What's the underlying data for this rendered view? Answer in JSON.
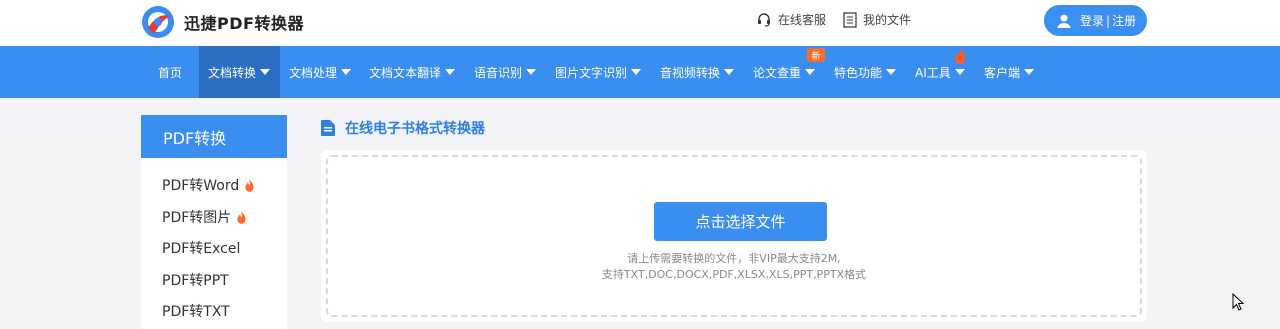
{
  "header": {
    "logo_text": "迅捷PDF转换器",
    "customer_service": "在线客服",
    "my_files": "我的文件",
    "login": "登录",
    "register": "注册",
    "login_sep": "|"
  },
  "nav": {
    "items": [
      {
        "label": "首页",
        "dropdown": false
      },
      {
        "label": "文档转换",
        "dropdown": true,
        "active": true
      },
      {
        "label": "文档处理",
        "dropdown": true
      },
      {
        "label": "文档文本翻译",
        "dropdown": true
      },
      {
        "label": "语音识别",
        "dropdown": true
      },
      {
        "label": "图片文字识别",
        "dropdown": true
      },
      {
        "label": "音视频转换",
        "dropdown": true
      },
      {
        "label": "论文查重",
        "dropdown": true
      },
      {
        "label": "特色功能",
        "dropdown": true
      },
      {
        "label": "AI工具",
        "dropdown": true
      },
      {
        "label": "客户端",
        "dropdown": true
      }
    ],
    "new_badge": "新"
  },
  "sidebar": {
    "title": "PDF转换",
    "items": [
      {
        "label": "PDF转Word",
        "hot": true
      },
      {
        "label": "PDF转图片",
        "hot": true
      },
      {
        "label": "PDF转Excel",
        "hot": false
      },
      {
        "label": "PDF转PPT",
        "hot": false
      },
      {
        "label": "PDF转TXT",
        "hot": false
      }
    ]
  },
  "main": {
    "title": "在线电子书格式转换器",
    "upload_button": "点击选择文件",
    "hint_line1": "请上传需要转换的文件，非VIP最大支持2M,",
    "hint_line2": "支持TXT,DOC,DOCX,PDF,XLSX,XLS,PPT,PPTX格式"
  },
  "colors": {
    "primary": "#3a8ef0",
    "nav_active": "#2a6fc4",
    "hot": "#ff6a2a"
  }
}
